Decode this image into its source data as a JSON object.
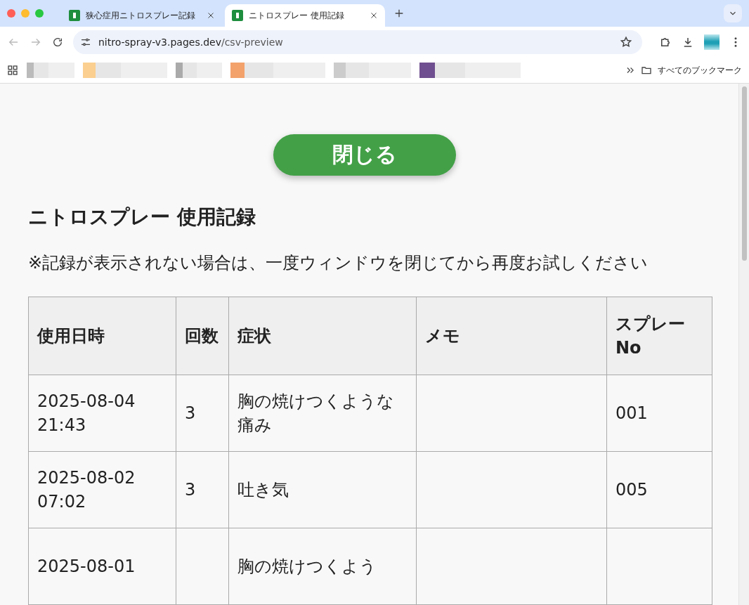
{
  "browser": {
    "tabs": [
      {
        "title": "狭心症用ニトロスプレー記録",
        "selected": false
      },
      {
        "title": "ニトロスプレー 使用記録",
        "selected": true
      }
    ],
    "address_host": "nitro-spray-v3.pages.dev",
    "address_path": "/csv-preview",
    "bookmarks_folder": "すべてのブックマーク"
  },
  "page": {
    "close_button": "閉じる",
    "heading": "ニトロスプレー 使用記録",
    "note": "※記録が表示されない場合は、一度ウィンドウを閉じてから再度お試しください",
    "table": {
      "columns": [
        "使用日時",
        "回数",
        "症状",
        "メモ",
        "スプレーNo"
      ],
      "rows": [
        {
          "cells": [
            "2025-08-04 21:43",
            "3",
            "胸の焼けつくような痛み",
            null,
            "001"
          ]
        },
        {
          "cells": [
            "2025-08-02 07:02",
            "3",
            "吐き気",
            null,
            "005"
          ]
        },
        {
          "cells": [
            "2025-08-01",
            null,
            "胸の焼けつくよう",
            null,
            null
          ]
        }
      ]
    }
  }
}
